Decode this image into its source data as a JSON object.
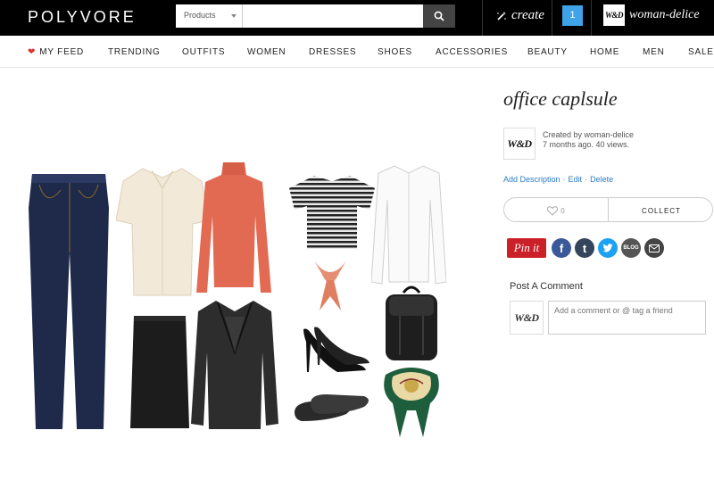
{
  "header": {
    "logo": "POLYVORE",
    "search": {
      "category": "Products",
      "placeholder": ""
    },
    "create_label": "create",
    "notification_count": "1",
    "username": "woman-delice",
    "avatar_text": "W&D"
  },
  "nav": {
    "items": [
      {
        "label": "MY FEED",
        "icon": "heart-icon"
      },
      {
        "label": "TRENDING"
      },
      {
        "label": "OUTFITS"
      },
      {
        "label": "WOMEN"
      },
      {
        "label": "DRESSES"
      },
      {
        "label": "SHOES"
      },
      {
        "label": "ACCESSORIES"
      },
      {
        "label": "BEAUTY"
      },
      {
        "label": "HOME"
      },
      {
        "label": "MEN"
      },
      {
        "label": "SALE"
      }
    ]
  },
  "set": {
    "title": "office caplsule",
    "creator_avatar": "W&D",
    "created_by": "Created by woman-delice",
    "meta": "7 months ago. 40 views.",
    "actions": [
      "Add Description",
      "Edit",
      "Delete"
    ],
    "like_count": "0",
    "collect_label": "COLLECT"
  },
  "share": {
    "pinit_label": "Pin it",
    "buttons": [
      {
        "name": "facebook-icon",
        "glyph": "f",
        "color": "#3b5998"
      },
      {
        "name": "tumblr-icon",
        "glyph": "t",
        "color": "#35465c"
      },
      {
        "name": "twitter-icon",
        "glyph": "",
        "color": "#1da1f2"
      },
      {
        "name": "blog-icon",
        "glyph": "BLOG",
        "color": "#555555"
      },
      {
        "name": "email-icon",
        "glyph": "",
        "color": "#444444"
      }
    ]
  },
  "comments": {
    "title": "Post A Comment",
    "avatar_text": "W&D",
    "placeholder": "Add a comment or @ tag a friend"
  },
  "colors": {
    "topbar": "#000000",
    "accent_blue": "#3ea3e8",
    "link_blue": "#2b7cc6",
    "pinterest_red": "#cb2027",
    "heart_red": "#d9302b"
  },
  "collage_items": [
    "jeans",
    "silk-blouse",
    "coral-turtleneck",
    "striped-tee",
    "white-shirt",
    "pencil-skirt",
    "black-blazer",
    "neck-scarf",
    "black-heels",
    "black-backpack",
    "black-flats",
    "silk-scarf"
  ]
}
